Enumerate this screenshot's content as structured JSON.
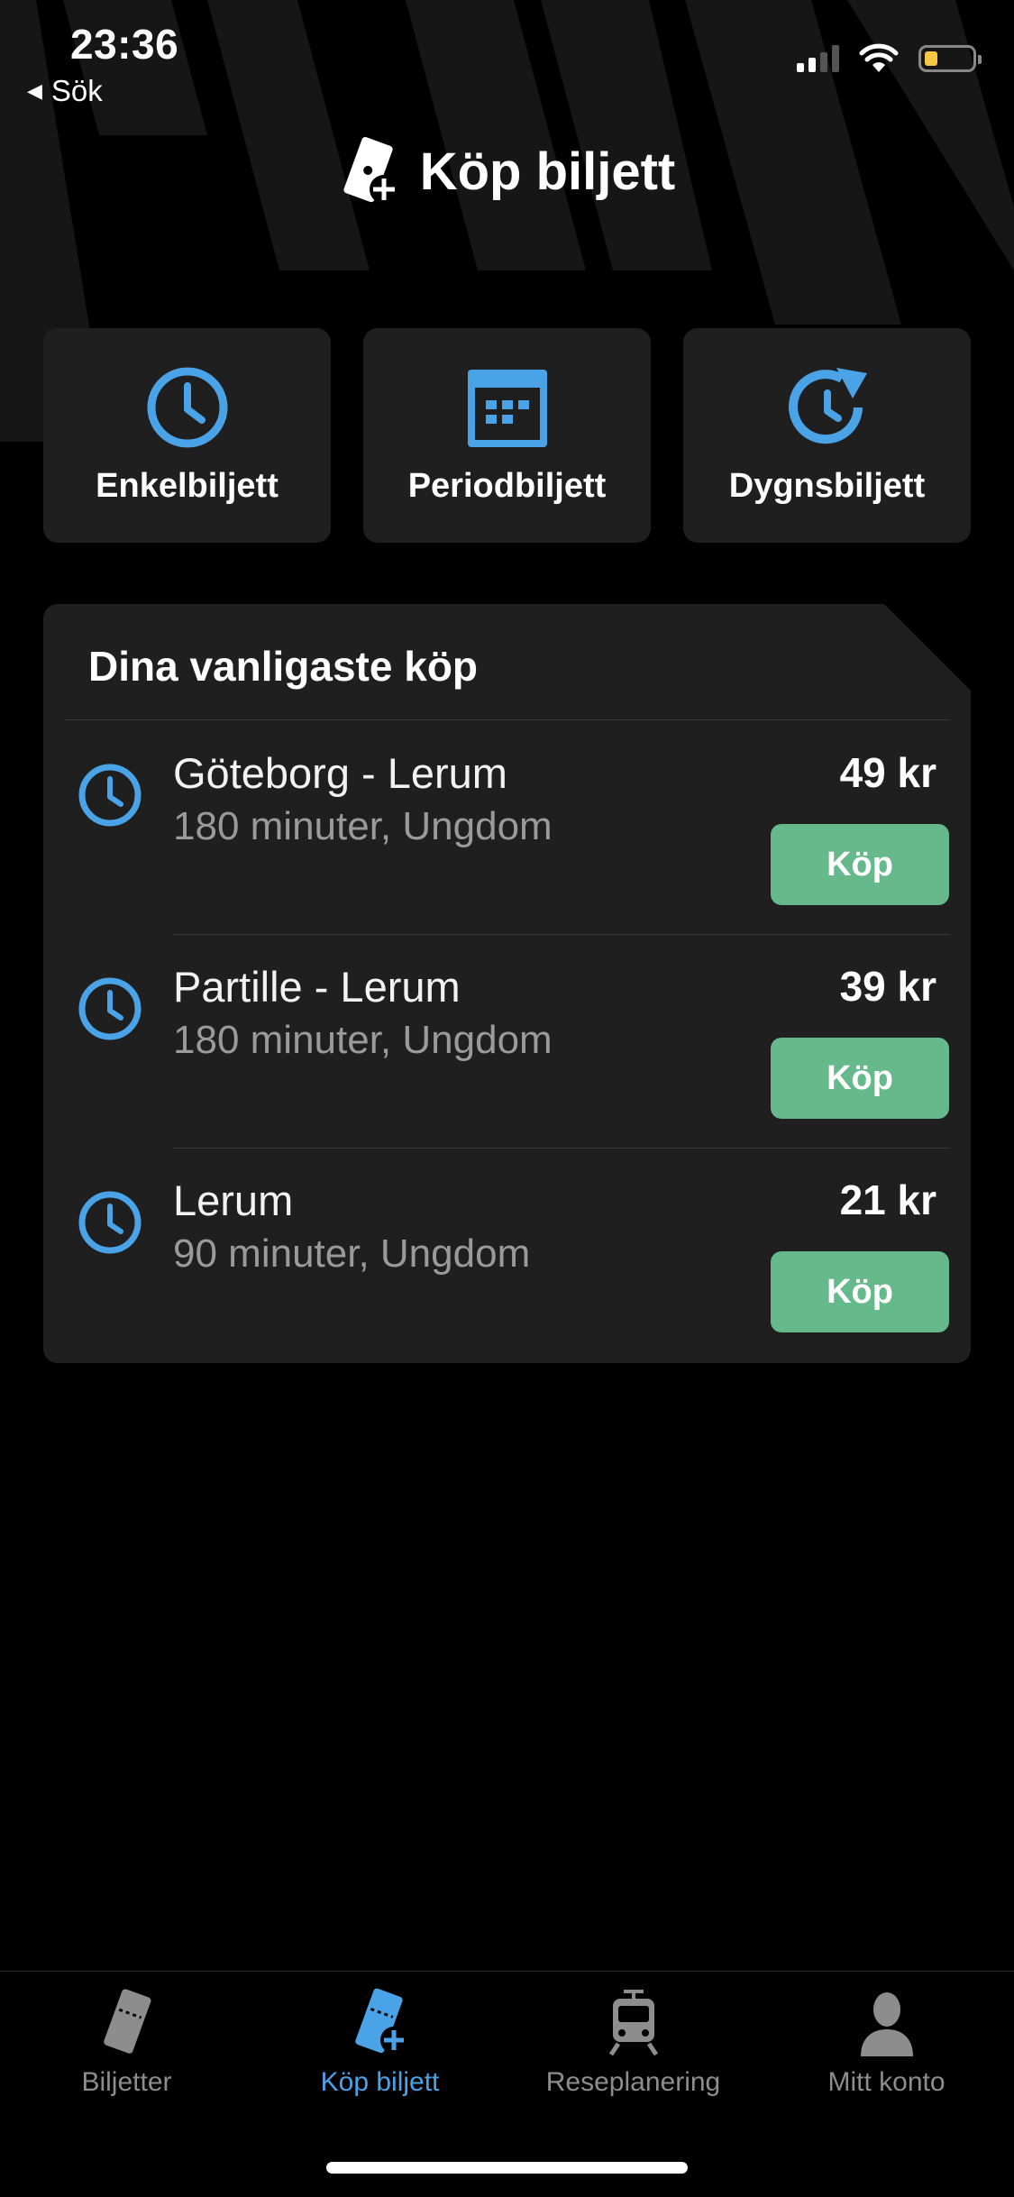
{
  "status_bar": {
    "time": "23:36",
    "back_label": "Sök",
    "battery_color": "#f5c842"
  },
  "header": {
    "title": "Köp biljett",
    "icon": "ticket-plus-icon"
  },
  "ticket_types": [
    {
      "label": "Enkelbiljett",
      "icon": "clock-icon"
    },
    {
      "label": "Periodbiljett",
      "icon": "calendar-icon"
    },
    {
      "label": "Dygnsbiljett",
      "icon": "clock-refresh-icon"
    }
  ],
  "frequent": {
    "title": "Dina vanligaste köp",
    "items": [
      {
        "route": "Göteborg - Lerum",
        "detail": "180 minuter, Ungdom",
        "price": "49 kr",
        "buy_label": "Köp"
      },
      {
        "route": "Partille - Lerum",
        "detail": "180 minuter, Ungdom",
        "price": "39 kr",
        "buy_label": "Köp"
      },
      {
        "route": "Lerum",
        "detail": "90 minuter, Ungdom",
        "price": "21 kr",
        "buy_label": "Köp"
      }
    ]
  },
  "tabbar": {
    "tabs": [
      {
        "label": "Biljetter",
        "icon": "ticket-icon"
      },
      {
        "label": "Köp biljett",
        "icon": "ticket-plus-icon",
        "active": true
      },
      {
        "label": "Reseplanering",
        "icon": "tram-icon"
      },
      {
        "label": "Mitt konto",
        "icon": "person-icon"
      }
    ]
  },
  "colors": {
    "accent": "#4aa3e6",
    "buy_button": "#66b98a",
    "card_bg": "#1f1f1f",
    "background": "#000000"
  }
}
